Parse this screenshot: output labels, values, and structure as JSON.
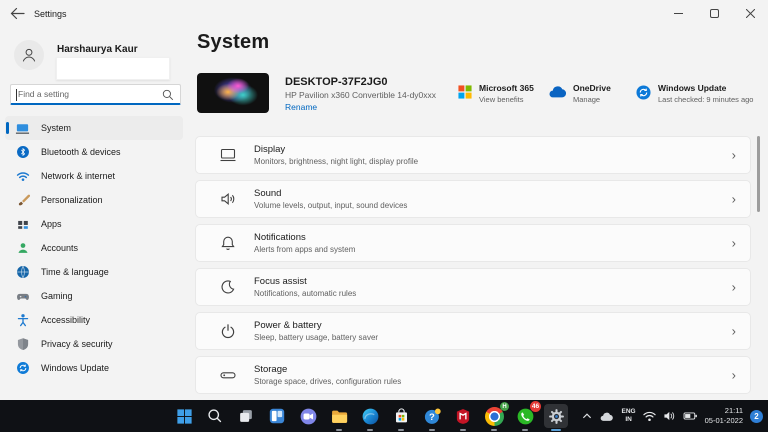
{
  "titlebar": {
    "title": "Settings"
  },
  "sidebar": {
    "user": {
      "name": "Harshaurya Kaur"
    },
    "search": {
      "placeholder": "Find a setting"
    },
    "items": [
      {
        "label": "System",
        "active": true
      },
      {
        "label": "Bluetooth & devices"
      },
      {
        "label": "Network & internet"
      },
      {
        "label": "Personalization"
      },
      {
        "label": "Apps"
      },
      {
        "label": "Accounts"
      },
      {
        "label": "Time & language"
      },
      {
        "label": "Gaming"
      },
      {
        "label": "Accessibility"
      },
      {
        "label": "Privacy & security"
      },
      {
        "label": "Windows Update"
      }
    ]
  },
  "main": {
    "page_title": "System",
    "device": {
      "name": "DESKTOP-37F2JG0",
      "model": "HP Pavilion x360 Convertible 14-dy0xxx",
      "rename_label": "Rename"
    },
    "status": [
      {
        "title": "Microsoft 365",
        "subtitle": "View benefits"
      },
      {
        "title": "OneDrive",
        "subtitle": "Manage"
      },
      {
        "title": "Windows Update",
        "subtitle": "Last checked: 9 minutes ago"
      }
    ],
    "cards": [
      {
        "title": "Display",
        "subtitle": "Monitors, brightness, night light, display profile"
      },
      {
        "title": "Sound",
        "subtitle": "Volume levels, output, input, sound devices"
      },
      {
        "title": "Notifications",
        "subtitle": "Alerts from apps and system"
      },
      {
        "title": "Focus assist",
        "subtitle": "Notifications, automatic rules"
      },
      {
        "title": "Power & battery",
        "subtitle": "Sleep, battery usage, battery saver"
      },
      {
        "title": "Storage",
        "subtitle": "Storage space, drives, configuration rules"
      }
    ]
  },
  "taskbar": {
    "icons": [
      "start",
      "search",
      "task-view",
      "widgets",
      "chat",
      "file-explorer",
      "edge",
      "microsoft-store",
      "get-help",
      "mcafee",
      "chrome",
      "whatsapp",
      "settings"
    ],
    "badges": {
      "whatsapp": "46",
      "chrome": "H"
    },
    "tray": {
      "language": "ENG",
      "region": "IN",
      "time": "21:11",
      "date": "05-01-2022",
      "notification_count": "2"
    }
  },
  "ui": {
    "chevron": "›"
  },
  "colors": {
    "accent": "#0067c0",
    "taskbar": "#0f1115",
    "card_bg": "#fbfbfb"
  }
}
